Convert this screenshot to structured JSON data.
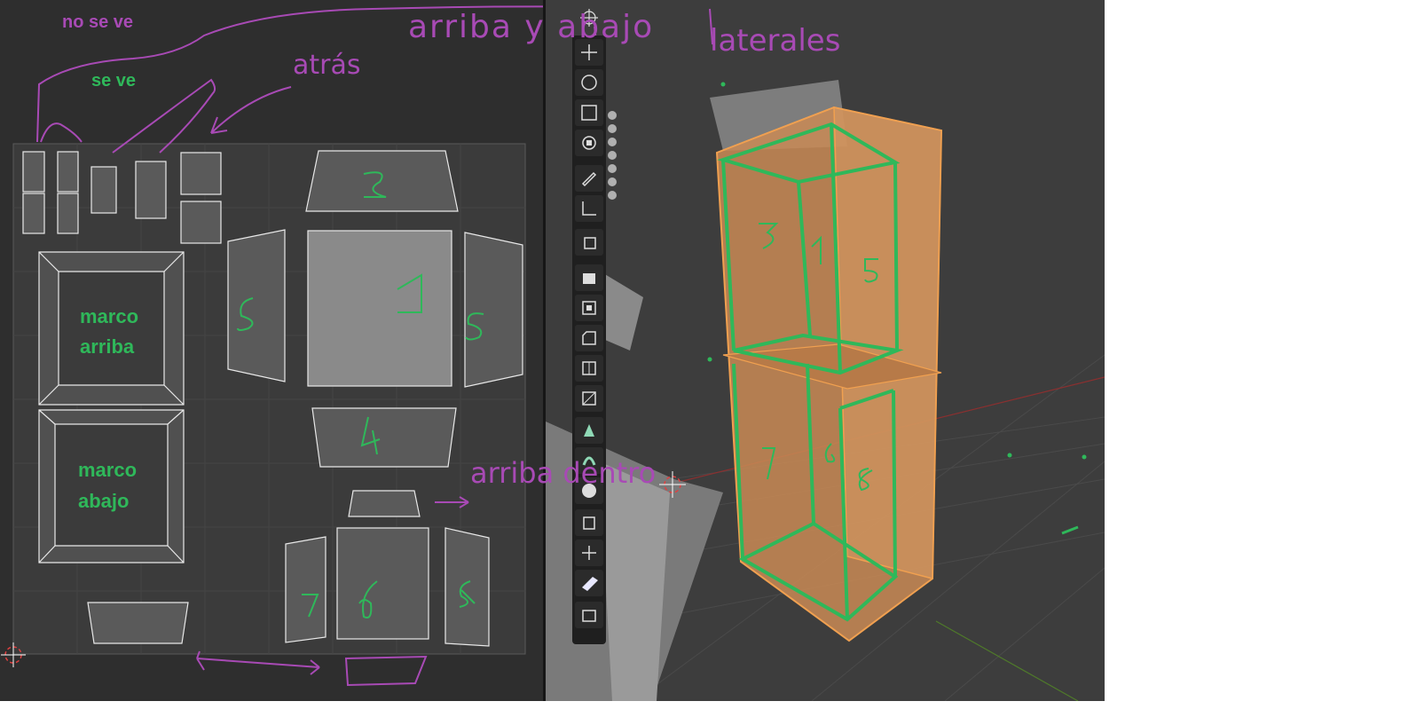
{
  "annotations": {
    "no_se_ve": "no se ve",
    "se_ve": "se ve",
    "marco_arriba_1": "marco",
    "marco_arriba_2": "arriba",
    "marco_abajo_1": "marco",
    "marco_abajo_2": "abajo"
  },
  "handwritten": {
    "arriba_y_abajo": "arriba y abajo",
    "laterales": "laterales",
    "atras": "atrás",
    "arriba_dentro": "arriba dentro"
  },
  "uv_numbers": [
    "1",
    "2",
    "4",
    "5",
    "5",
    "6",
    "7",
    "8"
  ],
  "viewport_numbers": [
    "1",
    "3",
    "5",
    "6",
    "7",
    "8"
  ],
  "toolbar": {
    "tools": [
      "cursor-icon",
      "move-icon",
      "rotate-icon",
      "scale-icon",
      "transform-icon",
      "annotate-icon",
      "measure-icon",
      "add-cube-icon",
      "extrude-icon",
      "inset-icon",
      "bevel-icon",
      "loop-cut-icon",
      "knife-icon",
      "poly-build-icon",
      "spin-icon",
      "smooth-icon",
      "edge-slide-icon",
      "shrink-fatten-icon",
      "shear-icon",
      "rip-icon"
    ]
  },
  "colors": {
    "annotation_green": "#2fb85a",
    "annotation_purple": "#a84ab5",
    "selection_orange": "#f0a050"
  }
}
